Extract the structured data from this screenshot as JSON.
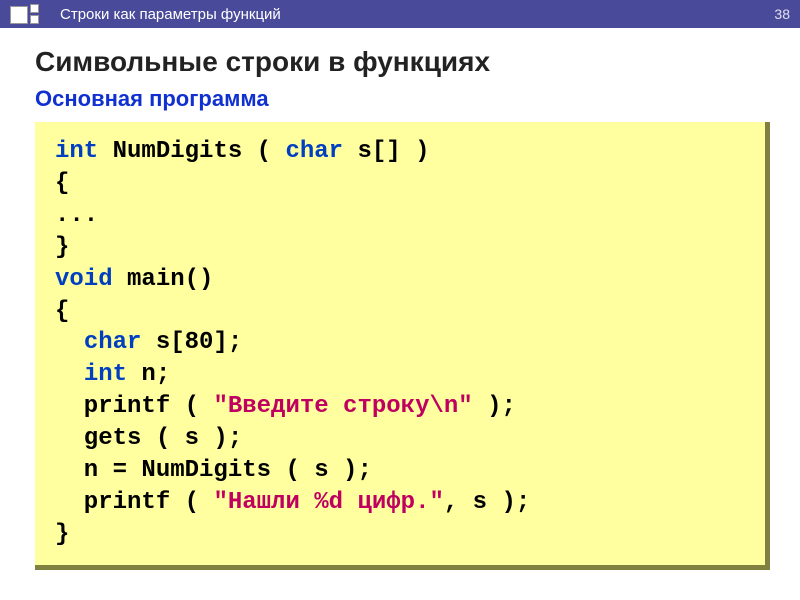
{
  "header": {
    "topic": "Строки как параметры функций",
    "page_number": "38"
  },
  "title": "Символьные строки в функциях",
  "subtitle": "Основная программа",
  "code": {
    "kw_int1": "int",
    "fn_name": " NumDigits ( ",
    "kw_char1": "char",
    "fn_sig_tail": " s[] )",
    "brace_open1": "{",
    "ellipsis": "...",
    "brace_close1": "}",
    "kw_void": "void",
    "main_sig": " main()",
    "brace_open2": "{",
    "indent": "  ",
    "kw_char2": "char",
    "decl_s": " s[80];",
    "kw_int2": "int",
    "decl_n": " n;",
    "printf1_a": "  printf ( ",
    "str1": "\"Введите строку\\n\"",
    "printf1_b": " );",
    "gets_line": "  gets ( s );",
    "assign_line": "  n = NumDigits ( s );",
    "printf2_a": "  printf ( ",
    "str2": "\"Нашли %d цифр.\"",
    "printf2_b": ", s );",
    "brace_close2": "}"
  }
}
